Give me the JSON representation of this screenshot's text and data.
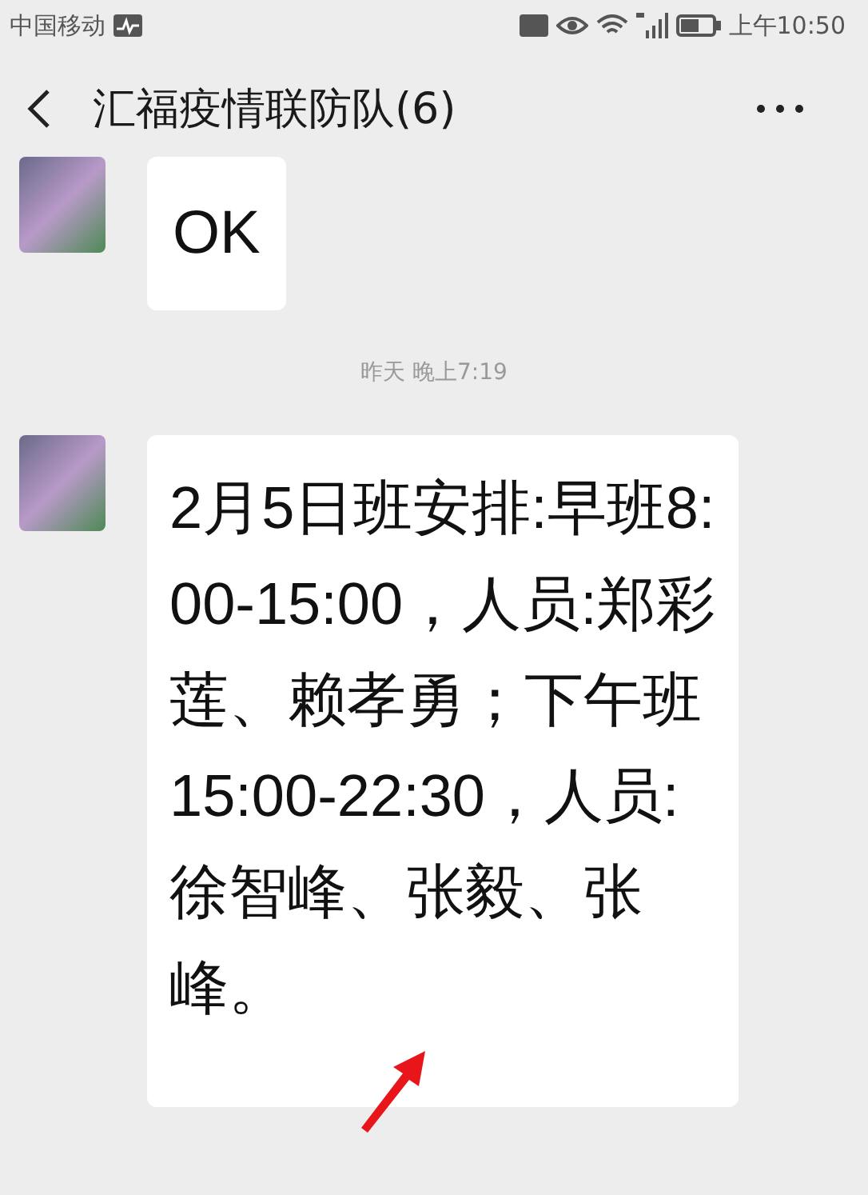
{
  "status_bar": {
    "carrier": "中国移动",
    "time": "上午10:50"
  },
  "header": {
    "title": "汇福疫情联防队(6)"
  },
  "messages": [
    {
      "kind": "text",
      "text": "OK"
    },
    {
      "kind": "timestamp",
      "text": "昨天 晚上7:19"
    },
    {
      "kind": "text",
      "text": "2月5日班安排:早班8:00-15:00，人员:郑彩莲、赖孝勇；下午班15:00-22:30，人员:徐智峰、张毅、张峰。"
    }
  ]
}
